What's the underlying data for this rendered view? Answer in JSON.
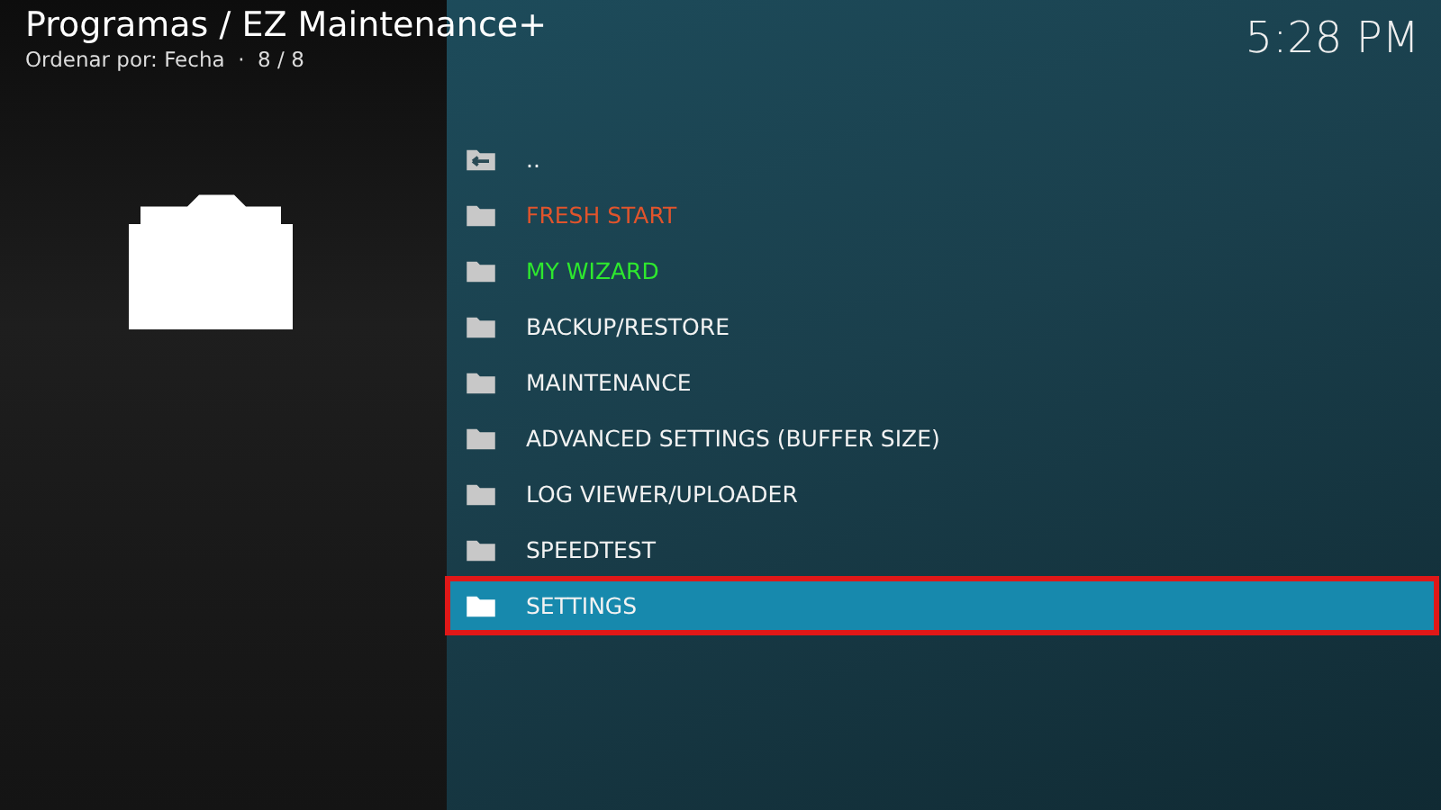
{
  "header": {
    "title": "Programas / EZ Maintenance+",
    "subtitle": "Ordenar por: Fecha  ·  8 / 8",
    "clock": "5:28 PM"
  },
  "list": [
    {
      "kind": "parent",
      "label": "..",
      "selected": false,
      "highlighted": false
    },
    {
      "kind": "folder",
      "label": "FRESH START",
      "color": "#e0542c",
      "selected": false,
      "highlighted": false
    },
    {
      "kind": "folder",
      "label": "MY WIZARD",
      "color": "#2ee82e",
      "selected": false,
      "highlighted": false
    },
    {
      "kind": "folder",
      "label": "BACKUP/RESTORE",
      "selected": false,
      "highlighted": false
    },
    {
      "kind": "folder",
      "label": "MAINTENANCE",
      "selected": false,
      "highlighted": false
    },
    {
      "kind": "folder",
      "label": "ADVANCED SETTINGS (BUFFER SIZE)",
      "selected": false,
      "highlighted": false
    },
    {
      "kind": "folder",
      "label": "LOG VIEWER/UPLOADER",
      "selected": false,
      "highlighted": false
    },
    {
      "kind": "folder",
      "label": "SPEEDTEST",
      "selected": false,
      "highlighted": false
    },
    {
      "kind": "folder",
      "label": "SETTINGS",
      "selected": true,
      "highlighted": true
    }
  ]
}
